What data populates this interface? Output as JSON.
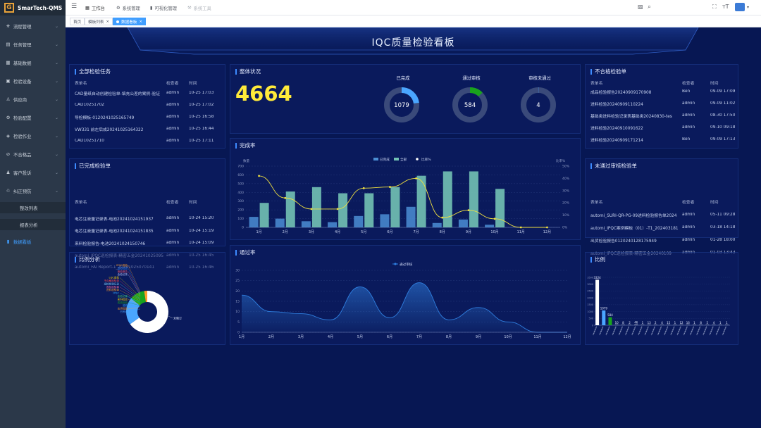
{
  "app": {
    "name": "SmarTech-QMS",
    "logo_letter": "G"
  },
  "sidebar": {
    "items": [
      {
        "label": "流程管理",
        "icon": "flow-icon",
        "glyph": "⎈"
      },
      {
        "label": "任务管理",
        "icon": "task-icon",
        "glyph": "▤"
      },
      {
        "label": "基础数据",
        "icon": "database-icon",
        "glyph": "▦"
      },
      {
        "label": "检验设备",
        "icon": "device-icon",
        "glyph": "▣"
      },
      {
        "label": "供应商",
        "icon": "supplier-icon",
        "glyph": "♙"
      },
      {
        "label": "检验配置",
        "icon": "config-icon",
        "glyph": "⚙"
      },
      {
        "label": "检验作业",
        "icon": "work-icon",
        "glyph": "◈"
      },
      {
        "label": "不合格品",
        "icon": "defect-icon",
        "glyph": "⊘"
      },
      {
        "label": "客户投诉",
        "icon": "complaint-icon",
        "glyph": "♟"
      },
      {
        "label": "纠正预防",
        "icon": "corrective-icon",
        "glyph": "♲"
      }
    ],
    "sub_items": [
      {
        "label": "整改列表"
      },
      {
        "label": "报表分析"
      }
    ],
    "bottom_item": {
      "label": "数据看板",
      "glyph": "▮"
    }
  },
  "topbar": {
    "nav": [
      {
        "label": "工作台",
        "glyph": "▦"
      },
      {
        "label": "系统管理",
        "glyph": "⚙"
      },
      {
        "label": "可视化管理",
        "glyph": "▮"
      },
      {
        "label": "系统工具",
        "glyph": "⚒"
      }
    ]
  },
  "tabs": [
    {
      "label": "首页"
    },
    {
      "label": "模板列表"
    },
    {
      "label": "数据看板"
    }
  ],
  "dashboard": {
    "title": "IQC质量检验看板",
    "all_tasks": {
      "title": "全部检验任务",
      "headers": [
        "表单名",
        "检查者",
        "时间"
      ],
      "rows": [
        [
          "CAD量纸自动创建检验单-填充公差的案例-验证",
          "admin",
          "10-25 17:03"
        ],
        [
          "CAD10251702",
          "admin",
          "10-25 17:02"
        ],
        [
          "导检模板-0120241025165749",
          "admin",
          "10-25 16:58"
        ],
        [
          "VW331 前左后成20241025164322",
          "admin",
          "10-25 16:44"
        ],
        [
          "CAD10251710",
          "admin",
          "10-25 17:11"
        ]
      ]
    },
    "overall": {
      "title": "整体状况",
      "total": "4664",
      "rings": [
        {
          "label": "已完成",
          "value": "1079",
          "fraction": 0.23,
          "color": "#4aa6ff"
        },
        {
          "label": "通过审核",
          "value": "584",
          "fraction": 0.125,
          "color": "#19a31d"
        },
        {
          "label": "审核未通过",
          "value": "4",
          "fraction": 0.002,
          "color": "#4aa6ff"
        }
      ]
    },
    "unqualified": {
      "title": "不合格检验单",
      "headers": [
        "表单名",
        "检查者",
        "时间"
      ],
      "rows": [
        [
          "成品检验报告20240909170908",
          "Ben",
          "09-09 17:09"
        ],
        [
          "进料检验20240909110224",
          "admin",
          "09-09 11:02"
        ],
        [
          "基础类进料检验记录表基础类20240830-tes",
          "admin",
          "08-30 17:50"
        ],
        [
          "进料检验20240910091622",
          "admin",
          "09-10 09:18"
        ],
        [
          "进料检验20240909171214",
          "Ben",
          "09-09 17:13"
        ]
      ]
    },
    "completed": {
      "title": "已完成检验单",
      "headers": [
        "表单名",
        "检查者",
        "时间"
      ],
      "rows": [
        [
          "电芯注液量记录表-电池20241024151937",
          "admin",
          "10-24 15:20"
        ],
        [
          "电芯注液量记录表-电池20241024151835",
          "admin",
          "10-24 15:19"
        ],
        [
          "来料检验报告-电池20241024150746",
          "admin",
          "10-24 15:09"
        ],
        [
          "automi_IPQC巡检报表-精密五金20241025095",
          "admin",
          "10-25 16:45"
        ],
        [
          "automi_FAI Report-1_20241025070141",
          "admin",
          "10-25 16:46"
        ]
      ]
    },
    "not_passed": {
      "title": "未通过审核检验单",
      "headers": [
        "表单名",
        "检查者",
        "时间"
      ],
      "rows": [
        [
          "automi_SURI-QR-PG-09进料检验报告单2024",
          "admin",
          "05-11 09:28"
        ],
        [
          "automi_IPQC案例模板（01）-T1_202403181",
          "admin",
          "03-18 14:18"
        ],
        [
          "出货检验报告0120240128175949",
          "admin",
          "01-28 18:00"
        ],
        [
          "automi_IPQC巡检报表-精密五金20240109",
          "admin",
          "01-03 13:43"
        ]
      ]
    },
    "pie_panel": {
      "title": "比例分析",
      "labels": [
        {
          "text": "IPQC巡检",
          "color": "#ff9d2a"
        },
        {
          "text": "首检检验",
          "color": "#3a8eff"
        },
        {
          "text": "首检报告",
          "color": "#ff5a6e"
        },
        {
          "text": "全检记录",
          "color": "#bdc8ff"
        },
        {
          "text": "LQC巡检",
          "color": "#ffd000"
        },
        {
          "text": "不合格检验单",
          "color": "#ff4d4d"
        },
        {
          "text": "巡检检验记录",
          "color": "#7ad0ff"
        },
        {
          "text": "首检检验单",
          "color": "#ff6a9a"
        },
        {
          "text": "进料检验单",
          "color": "#ff9d2a"
        },
        {
          "text": "IPQC",
          "color": "#2ea8ff"
        },
        {
          "text": "全检记录",
          "color": "#4ad06b"
        },
        {
          "text": "来料检验",
          "color": "#ffd000"
        },
        {
          "text": "成品检验",
          "color": "#19a31d"
        },
        {
          "text": "巡检",
          "color": "#2ea8ff"
        },
        {
          "text": "出货检验",
          "color": "#ff9d2a"
        },
        {
          "text": "已完成",
          "color": "#4aa6ff"
        }
      ],
      "right_label": "未制订"
    }
  },
  "chart_data": [
    {
      "type": "bar",
      "title": "完成率",
      "categories": [
        "1月",
        "2月",
        "3月",
        "4月",
        "5月",
        "6月",
        "7月",
        "8月",
        "9月",
        "10月",
        "11月",
        "12月"
      ],
      "ylabel": "数量",
      "y2label": "比率%",
      "ylim": [
        0,
        700
      ],
      "yticks": [
        0,
        100,
        200,
        300,
        400,
        500,
        600,
        700
      ],
      "y2lim": [
        0,
        50
      ],
      "y2ticks": [
        "0%",
        "10%",
        "20%",
        "30%",
        "40%",
        "50%"
      ],
      "legend": [
        "已完成",
        "全部",
        "比率%"
      ],
      "legend_position": "top",
      "series": [
        {
          "name": "已完成",
          "color": "#4b8ed3",
          "values": [
            120,
            100,
            70,
            60,
            130,
            150,
            235,
            50,
            90,
            30,
            0,
            0
          ]
        },
        {
          "name": "全部",
          "color": "#72c2b4",
          "values": [
            280,
            410,
            460,
            390,
            390,
            460,
            590,
            640,
            640,
            440,
            0,
            0
          ]
        },
        {
          "name": "比率%",
          "color": "#f0e040",
          "axis": "y2",
          "values": [
            42,
            24,
            15,
            15,
            32,
            33,
            40,
            8,
            14,
            7,
            0,
            0
          ]
        }
      ]
    },
    {
      "type": "area",
      "title": "通过率",
      "categories": [
        "1月",
        "2月",
        "3月",
        "4月",
        "5月",
        "6月",
        "7月",
        "8月",
        "9月",
        "10月",
        "11月",
        "12月"
      ],
      "ylim": [
        0,
        30
      ],
      "yticks": [
        0,
        5,
        10,
        15,
        20,
        25,
        30
      ],
      "legend": [
        "通过审核"
      ],
      "legend_position": "top",
      "series": [
        {
          "name": "通过审核",
          "color": "#2f7fe0",
          "values": [
            18,
            10,
            9,
            6,
            22,
            7,
            24,
            6,
            12,
            5,
            0,
            0
          ]
        }
      ]
    },
    {
      "type": "bar",
      "title": "比例",
      "ylim": [
        0,
        3500
      ],
      "yticks": [
        0,
        500,
        1000,
        1500,
        2000,
        2500,
        3000,
        3500
      ],
      "bars": [
        {
          "value": 3324,
          "label": "3324",
          "color": "#ffffff"
        },
        {
          "value": 1079,
          "label": "1079",
          "color": "#4aa6ff"
        },
        {
          "value": 584,
          "label": "584",
          "color": "#19a31d"
        },
        {
          "value": 10,
          "label": "10",
          "color": "#bcc4d8"
        },
        {
          "value": 8,
          "label": "8",
          "color": "#bcc4d8"
        },
        {
          "value": 2,
          "label": "2",
          "color": "#bcc4d8"
        },
        {
          "value": 46,
          "label": "46",
          "color": "#bcc4d8"
        },
        {
          "value": 1,
          "label": "1",
          "color": "#bcc4d8"
        },
        {
          "value": 13,
          "label": "13",
          "color": "#bcc4d8"
        },
        {
          "value": 2,
          "label": "2",
          "color": "#bcc4d8"
        },
        {
          "value": 4,
          "label": "4",
          "color": "#bcc4d8"
        },
        {
          "value": 15,
          "label": "15",
          "color": "#bcc4d8"
        },
        {
          "value": 1,
          "label": "1",
          "color": "#bcc4d8"
        },
        {
          "value": 12,
          "label": "12",
          "color": "#bcc4d8"
        },
        {
          "value": 16,
          "label": "16",
          "color": "#bcc4d8"
        },
        {
          "value": 1,
          "label": "1",
          "color": "#bcc4d8"
        },
        {
          "value": 8,
          "label": "8",
          "color": "#bcc4d8"
        },
        {
          "value": 5,
          "label": "5",
          "color": "#bcc4d8"
        },
        {
          "value": 4,
          "label": "4",
          "color": "#bcc4d8"
        },
        {
          "value": 1,
          "label": "1",
          "color": "#bcc4d8"
        },
        {
          "value": 1,
          "label": "1",
          "color": "#bcc4d8"
        }
      ]
    },
    {
      "type": "pie",
      "title": "比例分析",
      "slices": [
        {
          "name": "未制订",
          "value": 3324,
          "color": "#ffffff"
        },
        {
          "name": "已完成",
          "value": 1079,
          "color": "#4aa6ff"
        },
        {
          "name": "成品检验",
          "value": 584,
          "color": "#19a31d"
        },
        {
          "name": "其他",
          "value": 120,
          "color": "#ff9d2a"
        }
      ]
    }
  ]
}
